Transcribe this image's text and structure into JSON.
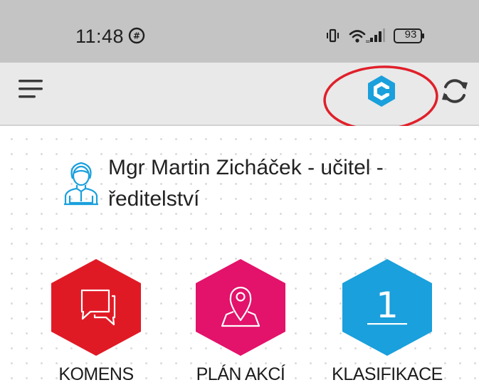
{
  "status_bar": {
    "time": "11:48",
    "battery": "93"
  },
  "app_bar": {
    "menu_icon": "hamburger-menu-icon",
    "logo_icon": "bakalari-logo-icon",
    "refresh_icon": "refresh-icon"
  },
  "user": {
    "name_line1": "Mgr Martin Zicháček - učitel -",
    "name_line2": "ředitelství",
    "icon": "user-avatar-icon"
  },
  "tiles": [
    {
      "label": "KOMENS",
      "icon": "chat-bubbles-icon",
      "color": "#e01a25"
    },
    {
      "label": "PLÁN AKCÍ",
      "icon": "map-pin-icon",
      "color": "#e3126b"
    },
    {
      "label": "KLASIFIKACE",
      "icon": "grade-one-icon",
      "glyph": "1",
      "color": "#1aa0dc"
    }
  ],
  "colors": {
    "status_bar_bg": "#c4c4c4",
    "app_bar_bg": "#e9e9e9",
    "accent_blue": "#1aa0dc",
    "highlight_ring": "#e0202a"
  }
}
